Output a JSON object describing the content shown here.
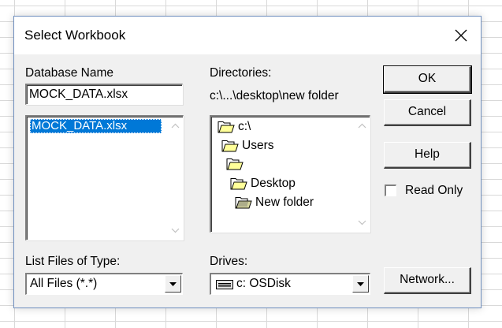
{
  "dialog": {
    "title": "Select Workbook",
    "database_name": {
      "label": "Database Name",
      "value": "MOCK_DATA.xlsx",
      "files": [
        "MOCK_DATA.xlsx"
      ]
    },
    "directories": {
      "label": "Directories:",
      "current_path": "c:\\...\\desktop\\new folder",
      "tree": [
        {
          "label": "c:\\",
          "icon": "open-folder-icon"
        },
        {
          "label": "Users",
          "icon": "open-folder-icon"
        },
        {
          "label": "",
          "icon": "open-folder-icon"
        },
        {
          "label": "Desktop",
          "icon": "open-folder-icon"
        },
        {
          "label": "New folder",
          "icon": "open-folder-icon"
        }
      ]
    },
    "buttons": {
      "ok": "OK",
      "cancel": "Cancel",
      "help": "Help",
      "network": "Network..."
    },
    "read_only": {
      "label": "Read Only",
      "checked": false
    },
    "file_type": {
      "label": "List Files of Type:",
      "value": "All Files (*.*)"
    },
    "drives": {
      "label": "Drives:",
      "value": "c: OSDisk",
      "icon": "drive-icon"
    }
  },
  "colors": {
    "selection": "#0078d7",
    "folder": "#ffff99",
    "dialog_bg": "#f0f0f0"
  }
}
